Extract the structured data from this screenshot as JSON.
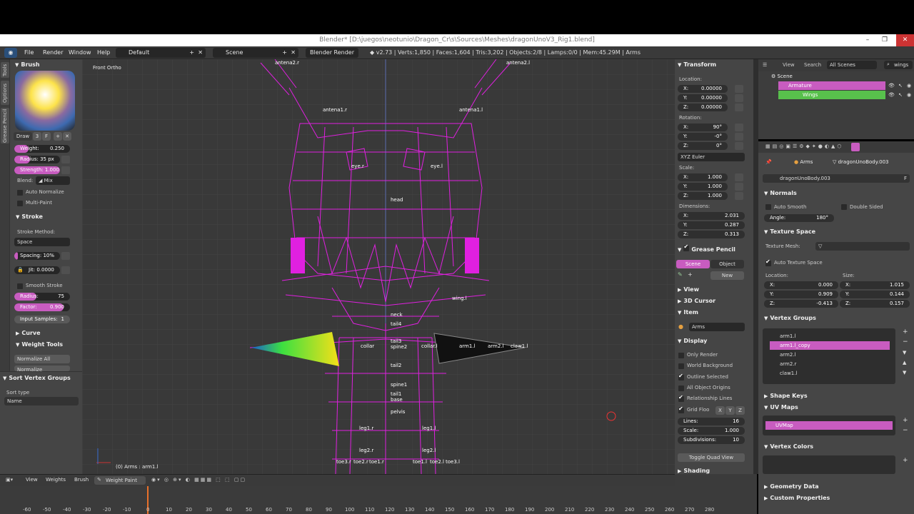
{
  "window": {
    "title": "Blender* [D:\\juegos\\neotunio\\Dragon_Cr\\s\\Sources\\Meshes\\dragonUnoV3_Rig1.blend]"
  },
  "info": {
    "menus": [
      "File",
      "Render",
      "Window",
      "Help"
    ],
    "layout": "Default",
    "scene": "Scene",
    "engine": "Blender Render",
    "stats": "v2.73 | Verts:1,850 | Faces:1,604 | Tris:3,202 | Objects:2/8 | Lamps:0/0 | Mem:45.29M | Arms"
  },
  "toolshelf": {
    "tabs": [
      "Tools",
      "Options",
      "Grease Pencil"
    ],
    "brush_header": "Brush",
    "draw_label": "Draw",
    "draw_num": "3",
    "draw_f": "F",
    "weight": "Weight:",
    "weight_val": "0.250",
    "weight_frac": 0.25,
    "radius": "Radius:",
    "radius_val": "35 px",
    "radius_frac": 0.35,
    "strength": "Strength:",
    "strength_val": "1.000",
    "strength_frac": 1.0,
    "blend": "Blend:",
    "blend_val": "Mix",
    "auto_normalize": "Auto Normalize",
    "multi_paint": "Multi-Paint",
    "stroke_header": "Stroke",
    "stroke_method": "Stroke Method:",
    "stroke_method_val": "Space",
    "spacing": "Spacing:",
    "spacing_val": "10%",
    "jitter": "Jit:",
    "jitter_val": "0.0000",
    "smooth_stroke": "Smooth Stroke",
    "s_radius": "Radius:",
    "s_radius_val": "75",
    "s_factor": "Factor:",
    "s_factor_val": "0.900",
    "input_samples": "Input Samples:",
    "input_samples_val": "1",
    "curve_header": "Curve",
    "weight_tools_header": "Weight Tools",
    "normalize_all": "Normalize All",
    "normalize": "Normalize",
    "sort_header": "Sort Vertex Groups",
    "sort_type": "Sort type",
    "sort_val": "Name"
  },
  "viewport": {
    "view_label": "Front Ortho",
    "status": "(0) Arms : arm1.l",
    "bones": [
      "antena2.r",
      "antena2.l",
      "antena1.r",
      "antena1.l",
      "eye.r",
      "eye.l",
      "head",
      "wing.l",
      "neck",
      "tail4",
      "tail3",
      "spine2",
      "collar",
      "collar.l",
      "arm1.l",
      "arm2.l",
      "claw1.l",
      "tail2",
      "spine1",
      "tail1",
      "base",
      "pelvis",
      "leg1.r",
      "leg1.l",
      "leg2.r",
      "leg2.l",
      "toe3.r",
      "toe2.r",
      "toe1.r",
      "toe1.l",
      "toe2.l",
      "toe3.l"
    ]
  },
  "viewport_header": {
    "items": [
      "View",
      "Weights",
      "Brush",
      "Weight Paint"
    ]
  },
  "npanel": {
    "transform": "Transform",
    "location": "Location:",
    "loc": [
      {
        "a": "X:",
        "v": "0.00000"
      },
      {
        "a": "Y:",
        "v": "0.00000"
      },
      {
        "a": "Z:",
        "v": "0.00000"
      }
    ],
    "rotation": "Rotation:",
    "rot": [
      {
        "a": "X:",
        "v": "90°"
      },
      {
        "a": "Y:",
        "v": "-0°"
      },
      {
        "a": "Z:",
        "v": "0°"
      }
    ],
    "euler": "XYZ Euler",
    "scale": "Scale:",
    "scl": [
      {
        "a": "X:",
        "v": "1.000"
      },
      {
        "a": "Y:",
        "v": "1.000"
      },
      {
        "a": "Z:",
        "v": "1.000"
      }
    ],
    "dimensions": "Dimensions:",
    "dim": [
      {
        "a": "X:",
        "v": "2.031"
      },
      {
        "a": "Y:",
        "v": "0.287"
      },
      {
        "a": "Z:",
        "v": "0.313"
      }
    ],
    "grease_pencil": "Grease Pencil",
    "gp_scene": "Scene",
    "gp_object": "Object",
    "gp_new": "New",
    "view": "View",
    "cursor": "3D Cursor",
    "item": "Item",
    "item_name": "Arms",
    "display": "Display",
    "only_render": "Only Render",
    "world_bg": "World Background",
    "outline_sel": "Outline Selected",
    "all_origins": "All Object Origins",
    "rel_lines": "Relationship Lines",
    "grid_floor": "Grid Floo",
    "axes": [
      "X",
      "Y",
      "Z"
    ],
    "lines": "Lines:",
    "lines_val": "16",
    "gscale": "Scale:",
    "gscale_val": "1.000",
    "subdiv": "Subdivisions:",
    "subdiv_val": "10",
    "quad": "Toggle Quad View",
    "shading": "Shading"
  },
  "outliner": {
    "view": "View",
    "search": "Search",
    "scenes": "All Scenes",
    "filter": "wings",
    "scene": "Scene",
    "armature": "Armature",
    "wings": "Wings"
  },
  "props": {
    "breadcrumb_obj": "Arms",
    "breadcrumb_mesh": "dragonUnoBody.003",
    "mesh_name": "dragonUnoBody.003",
    "mesh_f": "F",
    "normals": "Normals",
    "auto_smooth": "Auto Smooth",
    "double_sided": "Double Sided",
    "angle": "Angle:",
    "angle_val": "180°",
    "tex_space": "Texture Space",
    "tex_mesh": "Texture Mesh:",
    "auto_tex": "Auto Texture Space",
    "location": "Location:",
    "size": "Size:",
    "tloc": [
      {
        "a": "X:",
        "v": "0.000"
      },
      {
        "a": "Y:",
        "v": "0.909"
      },
      {
        "a": "Z:",
        "v": "-0.413"
      }
    ],
    "tsize": [
      {
        "a": "X:",
        "v": "1.015"
      },
      {
        "a": "Y:",
        "v": "0.144"
      },
      {
        "a": "Z:",
        "v": "0.157"
      }
    ],
    "vgroups": "Vertex Groups",
    "vg_list": [
      "arm1.l",
      "arm1.l_copy",
      "arm2.l",
      "arm2.r",
      "claw1.l"
    ],
    "shape_keys": "Shape Keys",
    "uv_maps": "UV Maps",
    "uvmap": "UVMap",
    "vcolors": "Vertex Colors",
    "geo_data": "Geometry Data",
    "custom_props": "Custom Properties"
  },
  "timeline": {
    "ticks": [
      "-60",
      "-50",
      "-40",
      "-30",
      "-20",
      "-10",
      "0",
      "10",
      "20",
      "30",
      "40",
      "50",
      "60",
      "70",
      "80",
      "90",
      "100",
      "110",
      "120",
      "130",
      "140",
      "150",
      "160",
      "170",
      "180",
      "190",
      "200",
      "210",
      "220",
      "230",
      "240",
      "250",
      "260",
      "270",
      "280"
    ]
  },
  "colors": {
    "accent": "#c85cc0",
    "green": "#6ccf3c",
    "panel": "#454545",
    "viewport": "#393939",
    "wire": "#e020e0"
  }
}
